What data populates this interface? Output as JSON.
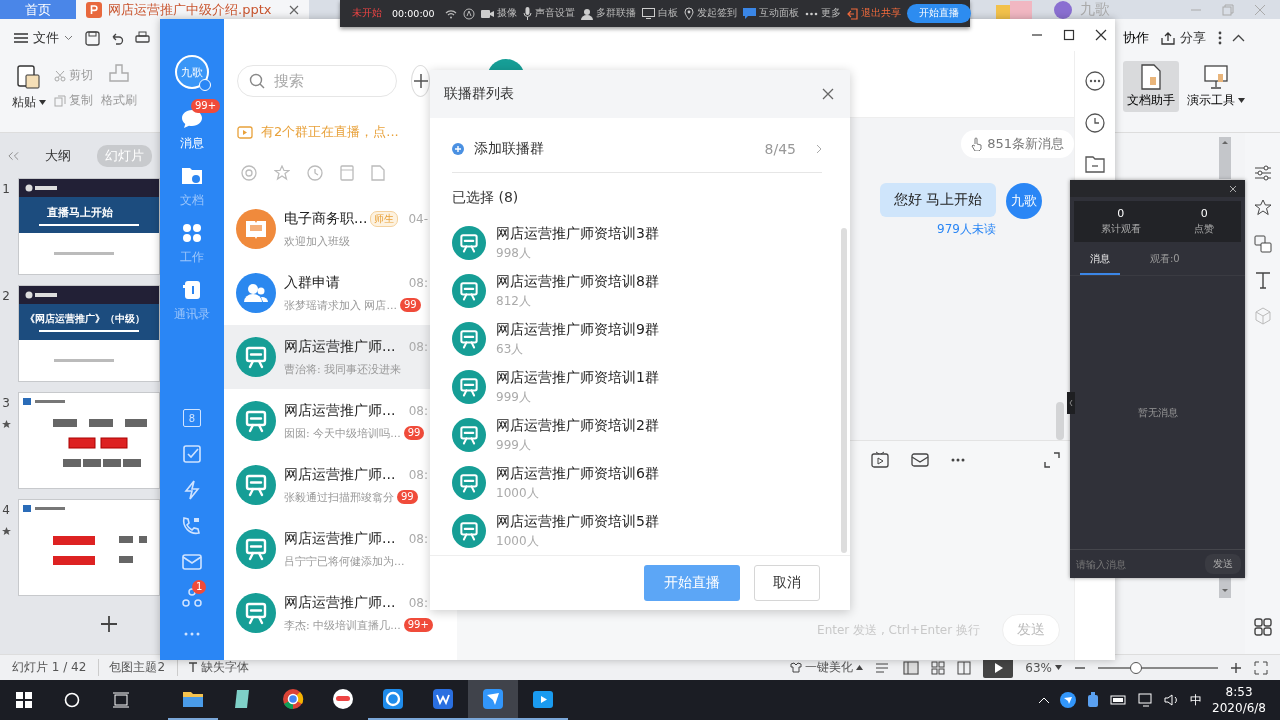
{
  "wps": {
    "tabs": [
      {
        "label": "首页",
        "kind": "home",
        "selected": false
      },
      {
        "label": "网店运营推广中级介绍.pptx",
        "kind": "file",
        "selected": true
      }
    ],
    "user": "九歌",
    "ribbon": {
      "file": "文件",
      "paste": "粘贴",
      "cut": "剪切",
      "copy": "复制",
      "format": "格式刷",
      "collab": "协作",
      "share": "分享",
      "tools": [
        {
          "label": "文档助手",
          "selected": true
        },
        {
          "label": "演示工具",
          "selected": false
        }
      ]
    },
    "slide_panel": {
      "tabs": [
        {
          "label": "大纲",
          "selected": false
        },
        {
          "label": "幻灯片",
          "selected": true
        }
      ],
      "slides": [
        {
          "number": "1",
          "kind": "title",
          "title": "直播马上开始",
          "starred": false
        },
        {
          "number": "2",
          "kind": "title",
          "title": "《网店运营推广》（中级）",
          "starred": false
        },
        {
          "number": "3",
          "kind": "diagram",
          "starred": true
        },
        {
          "number": "4",
          "kind": "diagram",
          "starred": true
        }
      ]
    },
    "status_bar": {
      "slide": "幻灯片 1 / 42",
      "theme": "包图主题2",
      "fonts": "缺失字体",
      "beautify": "一键美化",
      "zoom": "63%",
      "zoom_slider": {
        "level": 0.3
      }
    }
  },
  "share_toolbar": {
    "status": "未开始",
    "timer": "00:00:00",
    "items": [
      {
        "kind": "wifi"
      },
      {
        "kind": "circle"
      },
      {
        "kind": "camera",
        "label": "摄像"
      },
      {
        "kind": "mic",
        "label": "声音设置"
      },
      {
        "kind": "person",
        "label": "多群联播"
      },
      {
        "kind": "screen",
        "label": "白板"
      },
      {
        "kind": "pin",
        "label": "发起签到"
      },
      {
        "kind": "chat",
        "label": "互动面板"
      },
      {
        "kind": "dots",
        "label": "更多"
      }
    ],
    "exit": "退出共享",
    "start": "开始直播"
  },
  "chat_app": {
    "avatar": "九歌",
    "nav": [
      {
        "label": "消息",
        "kind": "chat",
        "selected": true,
        "badge": "99+"
      },
      {
        "label": "文档",
        "kind": "docs",
        "selected": false
      },
      {
        "label": "工作",
        "kind": "work",
        "selected": false
      },
      {
        "label": "通讯录",
        "kind": "contacts",
        "selected": false
      }
    ],
    "tools": [
      {
        "kind": "calendar",
        "text": "8"
      },
      {
        "kind": "check"
      },
      {
        "kind": "bolt"
      },
      {
        "kind": "phone"
      },
      {
        "kind": "mail"
      },
      {
        "kind": "network",
        "badge": "1"
      },
      {
        "kind": "more"
      }
    ],
    "search": {
      "placeholder": "搜索"
    },
    "notice": "有2个群正在直播，点...",
    "conversations": [
      {
        "kind": "class",
        "name": "电子商务职...",
        "tag": "师生",
        "time": "04-",
        "preview": "欢迎加入班级",
        "selected": false
      },
      {
        "kind": "request",
        "name": "入群申请",
        "time": "08:",
        "preview": "张梦瑶请求加入 网店...",
        "badge": "99",
        "selected": false
      },
      {
        "kind": "group",
        "name": "网店运营推广师...",
        "time": "08:",
        "preview": "曹治将: 我同事还没进来",
        "selected": true
      },
      {
        "kind": "group",
        "name": "网店运营推广师...",
        "time": "08:",
        "preview": "囡囡: 今天中级培训吗...",
        "badge": "99",
        "selected": false
      },
      {
        "kind": "group",
        "name": "网店运营推广师...",
        "time": "08:",
        "preview": "张毅通过扫描邢竣翕分",
        "badge": "99",
        "selected": false
      },
      {
        "kind": "group",
        "name": "网店运营推广师...",
        "time": "08:",
        "preview": "吕宁宁已将何健添加为...",
        "selected": false
      },
      {
        "kind": "group",
        "name": "网店运营推广师...",
        "time": "08:",
        "preview": "李杰: 中级培训直播几...",
        "badge": "99+",
        "selected": false
      }
    ],
    "new_messages": "851条新消息",
    "message": {
      "text": "您好 马上开始",
      "avatar": "九歌",
      "unread": "979人未读"
    },
    "input_hint": "Enter 发送 , Ctrl+Enter 换行",
    "send": "发送"
  },
  "dialog": {
    "title": "联播群列表",
    "add": "添加联播群",
    "count": "8/45",
    "selected_label": "已选择 (8)",
    "groups": [
      {
        "name": "网店运营推广师资培训3群",
        "members": "998人"
      },
      {
        "name": "网店运营推广师资培训8群",
        "members": "812人"
      },
      {
        "name": "网店运营推广师资培训9群",
        "members": "63人"
      },
      {
        "name": "网店运营推广师资培训1群",
        "members": "999人"
      },
      {
        "name": "网店运营推广师资培训2群",
        "members": "999人"
      },
      {
        "name": "网店运营推广师资培训6群",
        "members": "1000人"
      },
      {
        "name": "网店运营推广师资培训5群",
        "members": "1000人"
      }
    ],
    "start": "开始直播",
    "cancel": "取消"
  },
  "live_panel": {
    "stats": [
      {
        "value": "0",
        "label": "累计观看"
      },
      {
        "value": "0",
        "label": "点赞"
      }
    ],
    "tabs": [
      {
        "label": "消息",
        "selected": true
      },
      {
        "label": "观看:0",
        "selected": false
      }
    ],
    "empty": "暂无消息",
    "placeholder": "请输入消息",
    "send": "发送"
  },
  "taskbar": {
    "apps": [
      {
        "kind": "folder",
        "open": true,
        "selected": false
      },
      {
        "kind": "notepad",
        "open": false,
        "selected": false
      },
      {
        "kind": "chrome",
        "open": false,
        "selected": false
      },
      {
        "kind": "face",
        "open": false,
        "selected": false
      },
      {
        "kind": "cloud",
        "open": true,
        "selected": false
      },
      {
        "kind": "wps",
        "open": true,
        "selected": false
      },
      {
        "kind": "bird",
        "open": true,
        "selected": true
      },
      {
        "kind": "video",
        "open": true,
        "selected": false
      }
    ],
    "ime": "中",
    "time": "8:53",
    "date": "2020/6/8"
  }
}
